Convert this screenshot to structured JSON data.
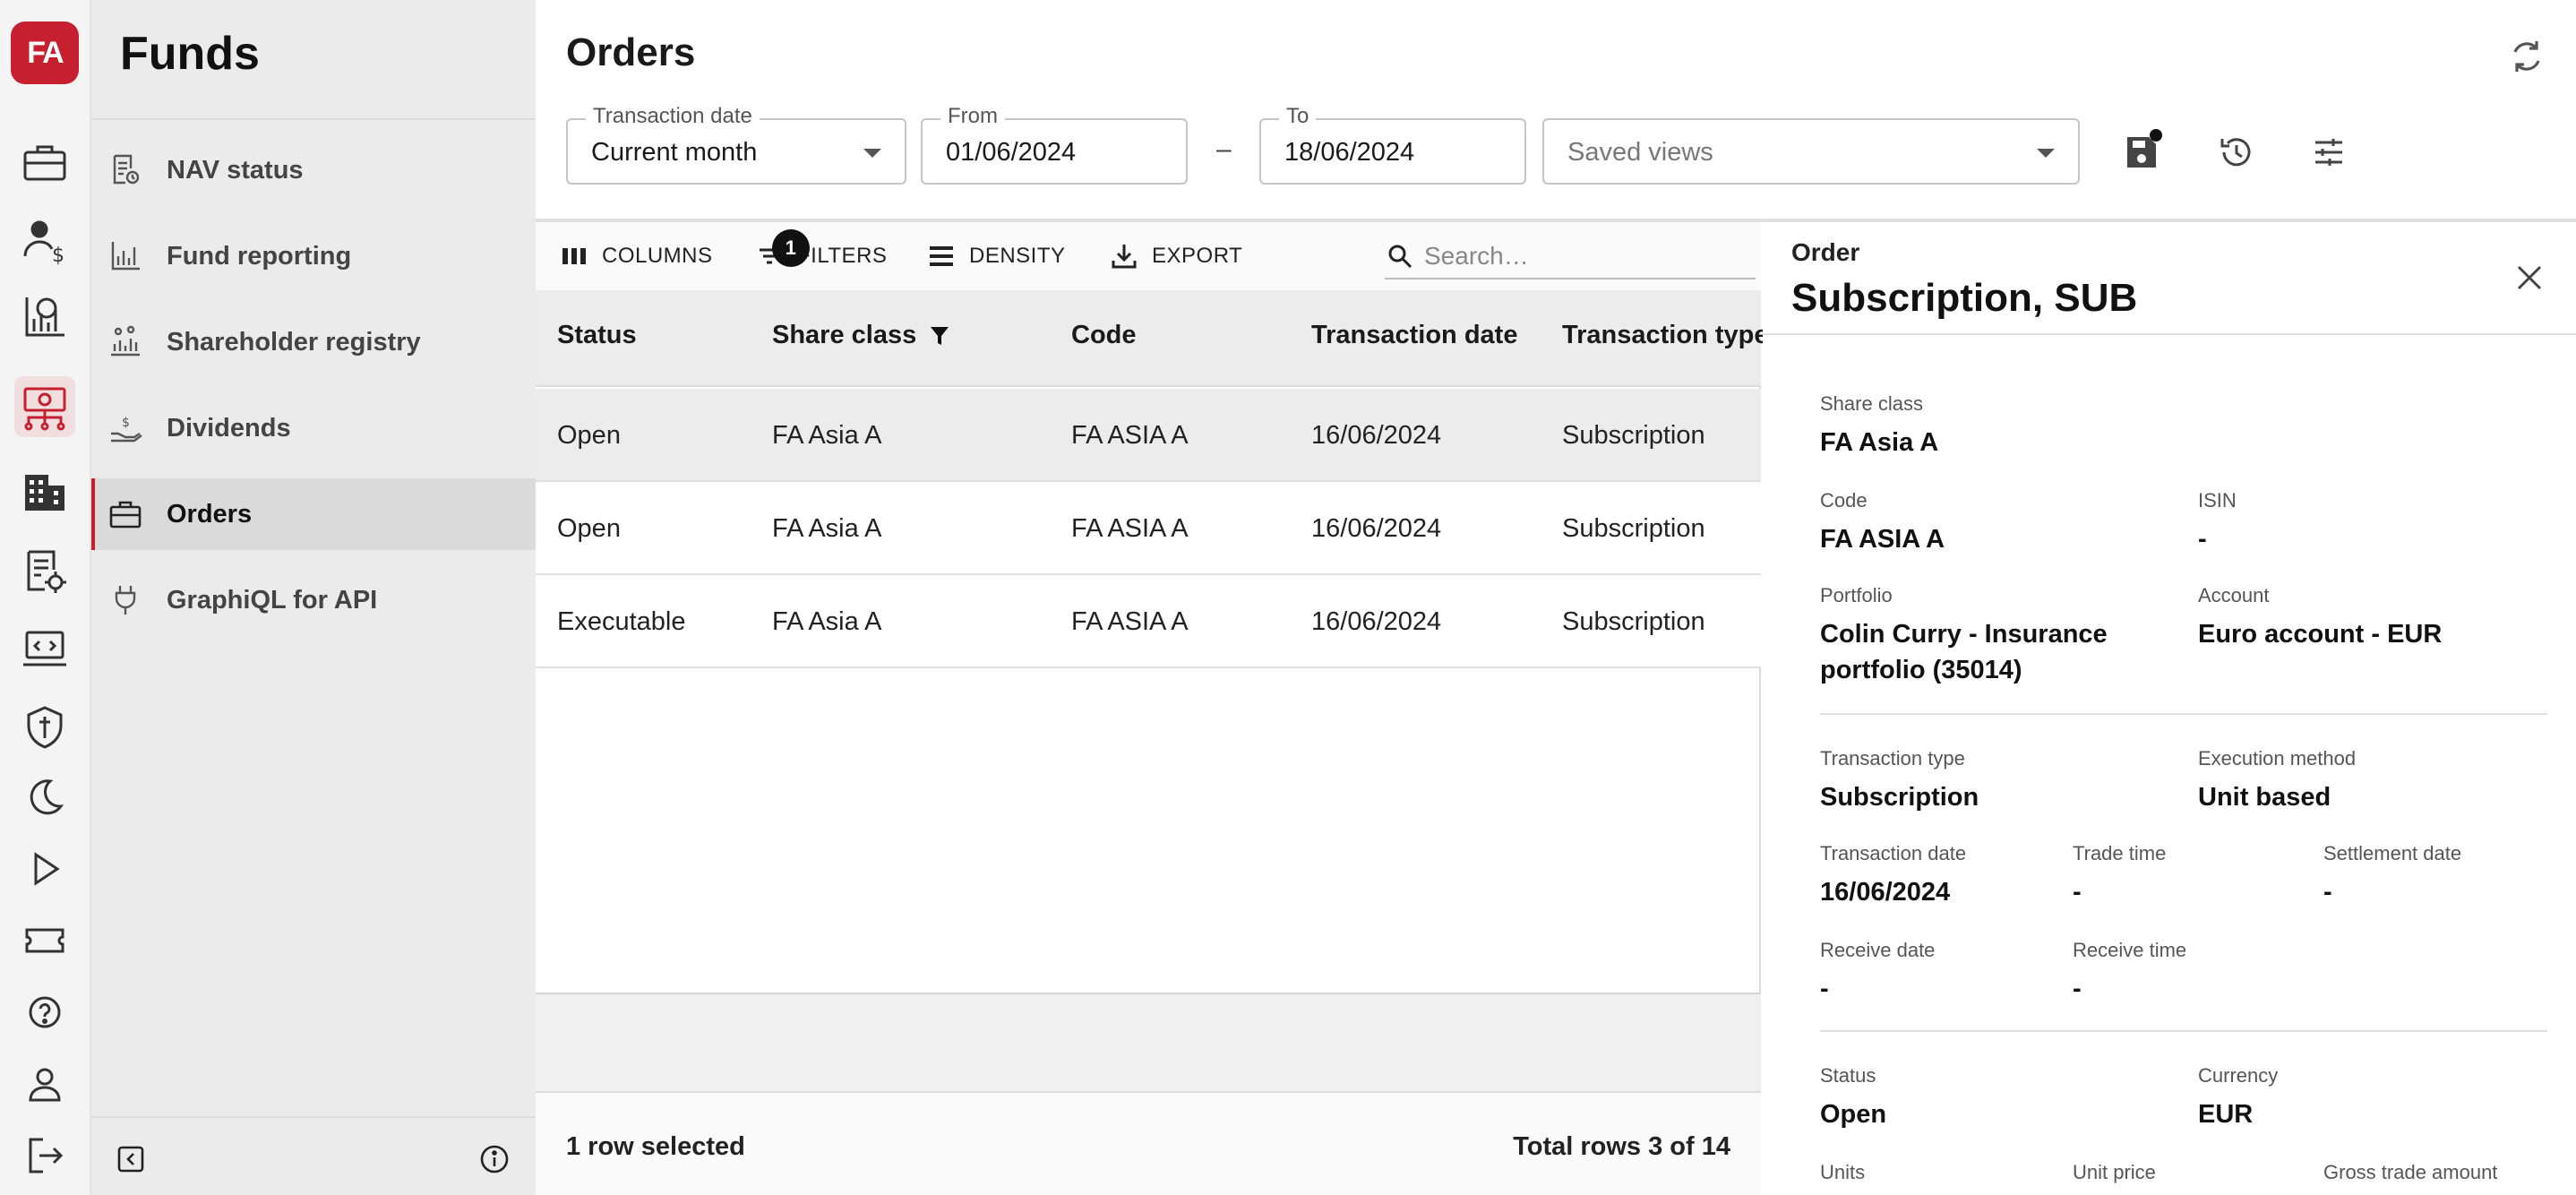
{
  "brand": {
    "logo_text": "FA",
    "accent": "#c62030"
  },
  "rail": {
    "icons": [
      "portfolio-briefcase-icon",
      "client-money-icon",
      "analytics-chart-icon",
      "funds-icon",
      "organization-building-icon",
      "reports-settings-icon",
      "developer-laptop-icon",
      "security-shield-icon",
      "dark-mode-moon-icon",
      "play-icon",
      "ticket-icon",
      "help-icon",
      "profile-icon",
      "logout-icon"
    ]
  },
  "sidebar": {
    "title": "Funds",
    "items": [
      {
        "label": "NAV status",
        "icon": "nav-report-icon"
      },
      {
        "label": "Fund reporting",
        "icon": "bar-chart-icon"
      },
      {
        "label": "Shareholder registry",
        "icon": "people-chart-icon"
      },
      {
        "label": "Dividends",
        "icon": "hand-coin-icon"
      },
      {
        "label": "Orders",
        "icon": "briefcase-icon",
        "active": true
      },
      {
        "label": "GraphiQL for API",
        "icon": "plug-icon"
      }
    ]
  },
  "header": {
    "title": "Orders",
    "transaction_date": {
      "label": "Transaction date",
      "value": "Current month"
    },
    "from": {
      "label": "From",
      "value": "01/06/2024"
    },
    "dash": "–",
    "to": {
      "label": "To",
      "value": "18/06/2024"
    },
    "saved_views": {
      "placeholder": "Saved views"
    }
  },
  "toolbar": {
    "columns": "COLUMNS",
    "filters": "FILTERS",
    "filters_count": "1",
    "density": "DENSITY",
    "export": "EXPORT",
    "search_placeholder": "Search…"
  },
  "table": {
    "columns": [
      "Status",
      "Share class",
      "Code",
      "Transaction date",
      "Transaction type"
    ],
    "rows": [
      {
        "status": "Open",
        "share_class": "FA Asia A",
        "code": "FA ASIA A",
        "transaction_date": "16/06/2024",
        "transaction_type": "Subscription",
        "selected": true
      },
      {
        "status": "Open",
        "share_class": "FA Asia A",
        "code": "FA ASIA A",
        "transaction_date": "16/06/2024",
        "transaction_type": "Subscription"
      },
      {
        "status": "Executable",
        "share_class": "FA Asia A",
        "code": "FA ASIA A",
        "transaction_date": "16/06/2024",
        "transaction_type": "Subscription"
      }
    ],
    "footer_selected": "1 row selected",
    "footer_total": "Total rows 3 of 14"
  },
  "panel": {
    "subtitle": "Order",
    "title": "Subscription, SUB",
    "share_class": {
      "label": "Share class",
      "value": "FA Asia A"
    },
    "code": {
      "label": "Code",
      "value": "FA ASIA A"
    },
    "isin": {
      "label": "ISIN",
      "value": "-"
    },
    "portfolio": {
      "label": "Portfolio",
      "value": "Colin Curry - Insurance portfolio (35014)"
    },
    "account": {
      "label": "Account",
      "value": "Euro account - EUR"
    },
    "transaction_type": {
      "label": "Transaction type",
      "value": "Subscription"
    },
    "execution_method": {
      "label": "Execution method",
      "value": "Unit based"
    },
    "transaction_date": {
      "label": "Transaction date",
      "value": "16/06/2024"
    },
    "trade_time": {
      "label": "Trade time",
      "value": "-"
    },
    "settlement_date": {
      "label": "Settlement date",
      "value": "-"
    },
    "receive_date": {
      "label": "Receive date",
      "value": "-"
    },
    "receive_time": {
      "label": "Receive time",
      "value": "-"
    },
    "status": {
      "label": "Status",
      "value": "Open"
    },
    "currency": {
      "label": "Currency",
      "value": "EUR"
    },
    "units": {
      "label": "Units"
    },
    "unit_price": {
      "label": "Unit price"
    },
    "gross_trade_amount": {
      "label": "Gross trade amount"
    }
  }
}
